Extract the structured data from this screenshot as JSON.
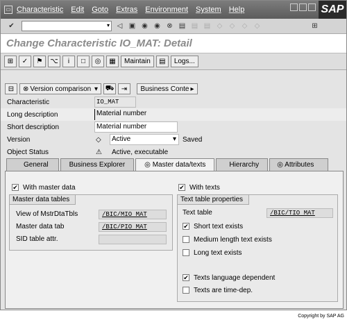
{
  "menu": [
    "Characteristic",
    "Edit",
    "Goto",
    "Extras",
    "Environment",
    "System",
    "Help"
  ],
  "logo": "SAP",
  "title": "Change Characteristic IO_MAT: Detail",
  "app_toolbar": {
    "maintain": "Maintain",
    "logs": "Logs..."
  },
  "toolbar2": {
    "version_comparison": "Version comparison",
    "business_content": "Business Conte"
  },
  "fields": {
    "characteristic_label": "Characteristic",
    "characteristic_value": "IO_MAT",
    "long_desc_label": "Long description",
    "long_desc_value": "Material number",
    "short_desc_label": "Short description",
    "short_desc_value": "Material number",
    "version_label": "Version",
    "version_value": "Active",
    "version_status": "Saved",
    "object_status_label": "Object Status",
    "object_status_value": "Active, executable"
  },
  "tabs": [
    "General",
    "Business Explorer",
    "Master data/texts",
    "Hierarchy",
    "Attributes"
  ],
  "master": {
    "with_master_data": "With master data",
    "group_title": "Master data tables",
    "view_label": "View of MstrDtaTbls",
    "view_value": "/BIC/MIO MAT",
    "tab_label": "Master data tab",
    "tab_value": "/BIC/PIO MAT",
    "sid_label": "SID table attr."
  },
  "texts": {
    "with_texts": "With texts",
    "group_title": "Text table properties",
    "text_table_label": "Text table",
    "text_table_value": "/BIC/TIO MAT",
    "short_text": "Short text exists",
    "medium_text": "Medium length text exists",
    "long_text": "Long text exists",
    "lang_dep": "Texts language dependent",
    "time_dep": "Texts are time-dep."
  },
  "copyright": "Copyright by SAP AG"
}
